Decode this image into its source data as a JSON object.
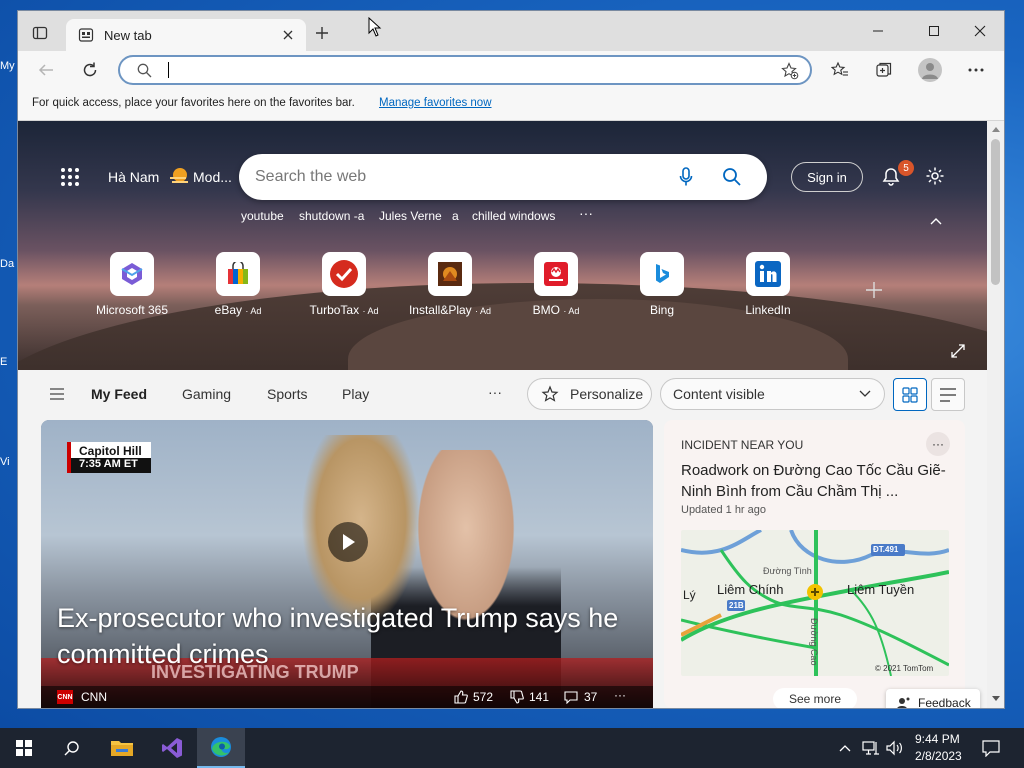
{
  "desktop": {
    "icons": [
      "My",
      "Da",
      "E",
      "Vi"
    ]
  },
  "browser": {
    "tab": {
      "title": "New tab"
    },
    "address": {
      "value": "",
      "placeholder": ""
    },
    "favbar": {
      "text": "For quick access, place your favorites here on the favorites bar.",
      "link": "Manage favorites now"
    }
  },
  "header": {
    "location": "Hà Nam",
    "weather": "Mod...",
    "search_placeholder": "Search the web",
    "sign_in": "Sign in",
    "notif_count": "5"
  },
  "suggestions": [
    "youtube",
    "shutdown -a",
    "Jules Verne",
    "a",
    "chilled windows",
    "···"
  ],
  "tiles": [
    {
      "label": "Microsoft 365",
      "ad": ""
    },
    {
      "label": "eBay",
      "ad": "· Ad"
    },
    {
      "label": "TurboTax",
      "ad": "· Ad"
    },
    {
      "label": "Install&Play",
      "ad": "· Ad"
    },
    {
      "label": "BMO",
      "ad": "· Ad"
    },
    {
      "label": "Bing",
      "ad": ""
    },
    {
      "label": "LinkedIn",
      "ad": ""
    }
  ],
  "feed": {
    "tabs": [
      "My Feed",
      "Gaming",
      "Sports",
      "Play"
    ],
    "more": "···",
    "personalize": "Personalize",
    "content_select": "Content visible"
  },
  "article": {
    "tag_line1": "Capitol Hill",
    "tag_line2": "7:35 AM ET",
    "headline": "Ex-prosecutor who investigated Trump says he committed crimes",
    "chyron": "INVESTIGATING TRUMP",
    "source": "CNN",
    "likes": "572",
    "dislikes": "141",
    "comments": "37",
    "more": "···"
  },
  "incident": {
    "kicker": "INCIDENT NEAR YOU",
    "title": "Roadwork on Đường Cao Tốc Cầu Giẽ-Ninh Bình from Cầu Chầm Thị ...",
    "updated": "Updated 1 hr ago",
    "more": "···",
    "map": {
      "place1": "Liêm Chính",
      "place2": "Liêm Tuyền",
      "road1": "Đường Tình",
      "road2": "Đường Cao",
      "route1": "21B",
      "route2": "ĐT.491",
      "ly": "Lý",
      "copyright": "© 2021 TomTom"
    },
    "see_more": "See more"
  },
  "feedback": "Feedback",
  "taskbar": {
    "time": "9:44 PM",
    "date": "2/8/2023"
  },
  "colors": {
    "accent": "#0067c0",
    "notif": "#d13438",
    "cnn": "#cc0000"
  }
}
